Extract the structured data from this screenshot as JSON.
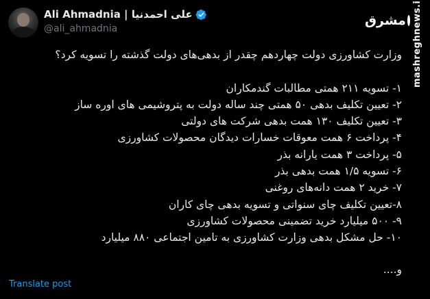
{
  "author": {
    "display_name": "Ali Ahmadnia | علی احمدنیا",
    "handle": "@ali_ahmadnia",
    "verified": true,
    "verified_color": "#1d9bf0"
  },
  "watermark": {
    "logo_text": "مشرق",
    "site_text": "mashreghnews.ir"
  },
  "post": {
    "question": "وزارت کشاورزی دولت چهاردهم چقدر از بدهی‌های دولت گذشته را تسویه کرد؟",
    "items": [
      "۱- تسویه ۲۱۱ همتی مطالبات گندمکاران",
      "۲- تعیین تکلیف بدهی ۵۰ همتی چند ساله دولت به پتروشیمی های اوره ساز",
      "۳- تعیین تکلیف ۱۳۰ همت بدهی شرکت های دولتی",
      "۴- پرداخت ۶ همت معوقات خسارات دیدگان محصولات کشاورزی",
      "۵- پرداخت ۳ همت یارانه بذر",
      "۶- تسویه ۱/۵ همت بدهی بذر",
      "۷- خرید ۲ همت دانه‌های روغنی",
      "۸-تعیین تکلیف چای سنواتی و تسویه بدهی چای کاران",
      "۹- ۵۰۰ میلیارد خرید تضمینی محصولات کشاورزی",
      "۱۰- حل مشکل بدهی وزارت کشاورزی به تامین اجتماعی ۸۸۰ میلیارد"
    ],
    "trailing": "و...."
  },
  "actions": {
    "translate_label": "Translate post"
  },
  "colors": {
    "background": "#000000",
    "text": "#e7e9ea",
    "secondary_text": "#71767b",
    "link": "#1d9bf0"
  }
}
